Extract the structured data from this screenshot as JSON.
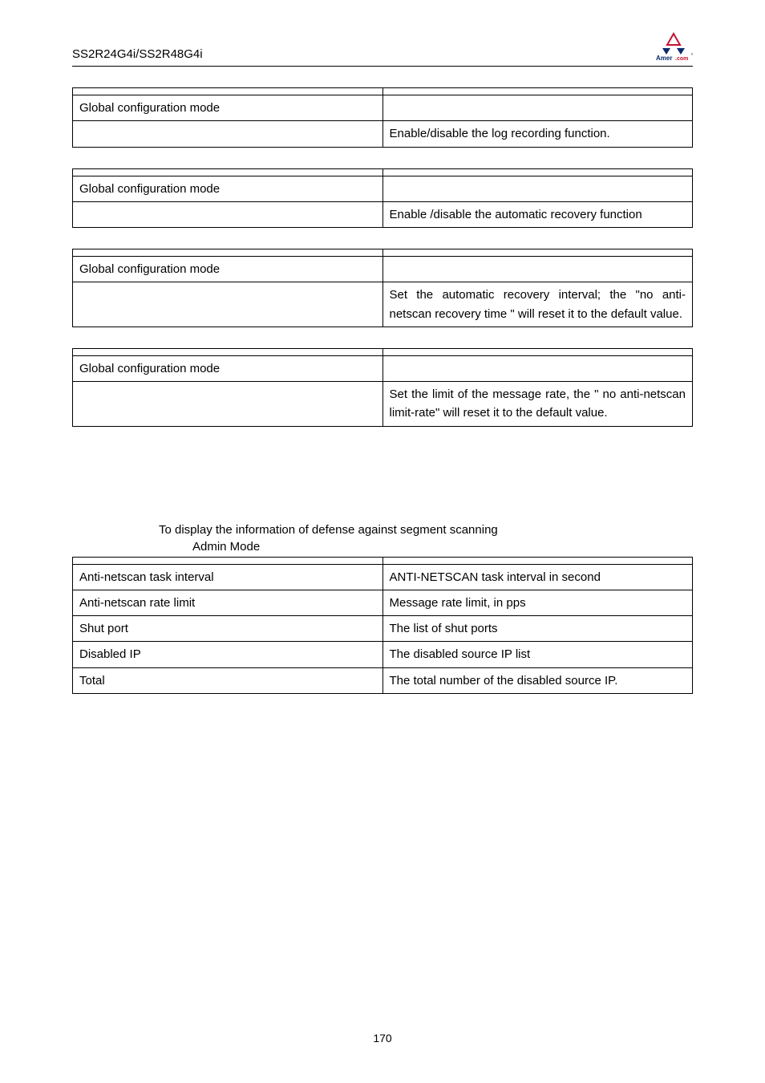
{
  "header": {
    "model": "SS2R24G4i/SS2R48G4i",
    "logo_brand": "Amer",
    "logo_suffix": ".com",
    "logo_tm": "™"
  },
  "tables": {
    "t1": {
      "r1c1": "",
      "r1c2": "",
      "r2c1": "Global configuration mode",
      "r2c2": "",
      "r3c1": "",
      "r3c2": "Enable/disable the log recording function."
    },
    "t2": {
      "r1c1": "",
      "r1c2": "",
      "r2c1": "Global configuration mode",
      "r2c2": "",
      "r3c1": "",
      "r3c2": "Enable /disable the automatic recovery function"
    },
    "t3": {
      "r1c1": "",
      "r1c2": "",
      "r2c1": "Global configuration mode",
      "r2c2": "",
      "r3c1": "",
      "r3c2": "Set the automatic recovery interval; the \"no anti-netscan recovery time \" will reset it to the default value."
    },
    "t4": {
      "r1c1": "",
      "r1c2": "",
      "r2c1": "Global configuration mode",
      "r2c2": "",
      "r3c1": "",
      "r3c2": "Set the limit of the message rate, the \" no anti-netscan limit-rate\" will reset it to the default value."
    },
    "t5": {
      "r1c1": "",
      "r1c2": "",
      "r2c1": "Anti-netscan task interval",
      "r2c2": "ANTI-NETSCAN task interval in second",
      "r3c1": "Anti-netscan rate limit",
      "r3c2": "Message rate limit, in pps",
      "r4c1": "Shut port",
      "r4c2": "The list of shut ports",
      "r5c1": "Disabled IP",
      "r5c2": "The disabled source IP list",
      "r6c1": "Total",
      "r6c2": "The total number of the disabled source IP."
    }
  },
  "info": {
    "line1": "To display the information of defense against segment scanning",
    "line2": "Admin Mode"
  },
  "page_number": "170"
}
